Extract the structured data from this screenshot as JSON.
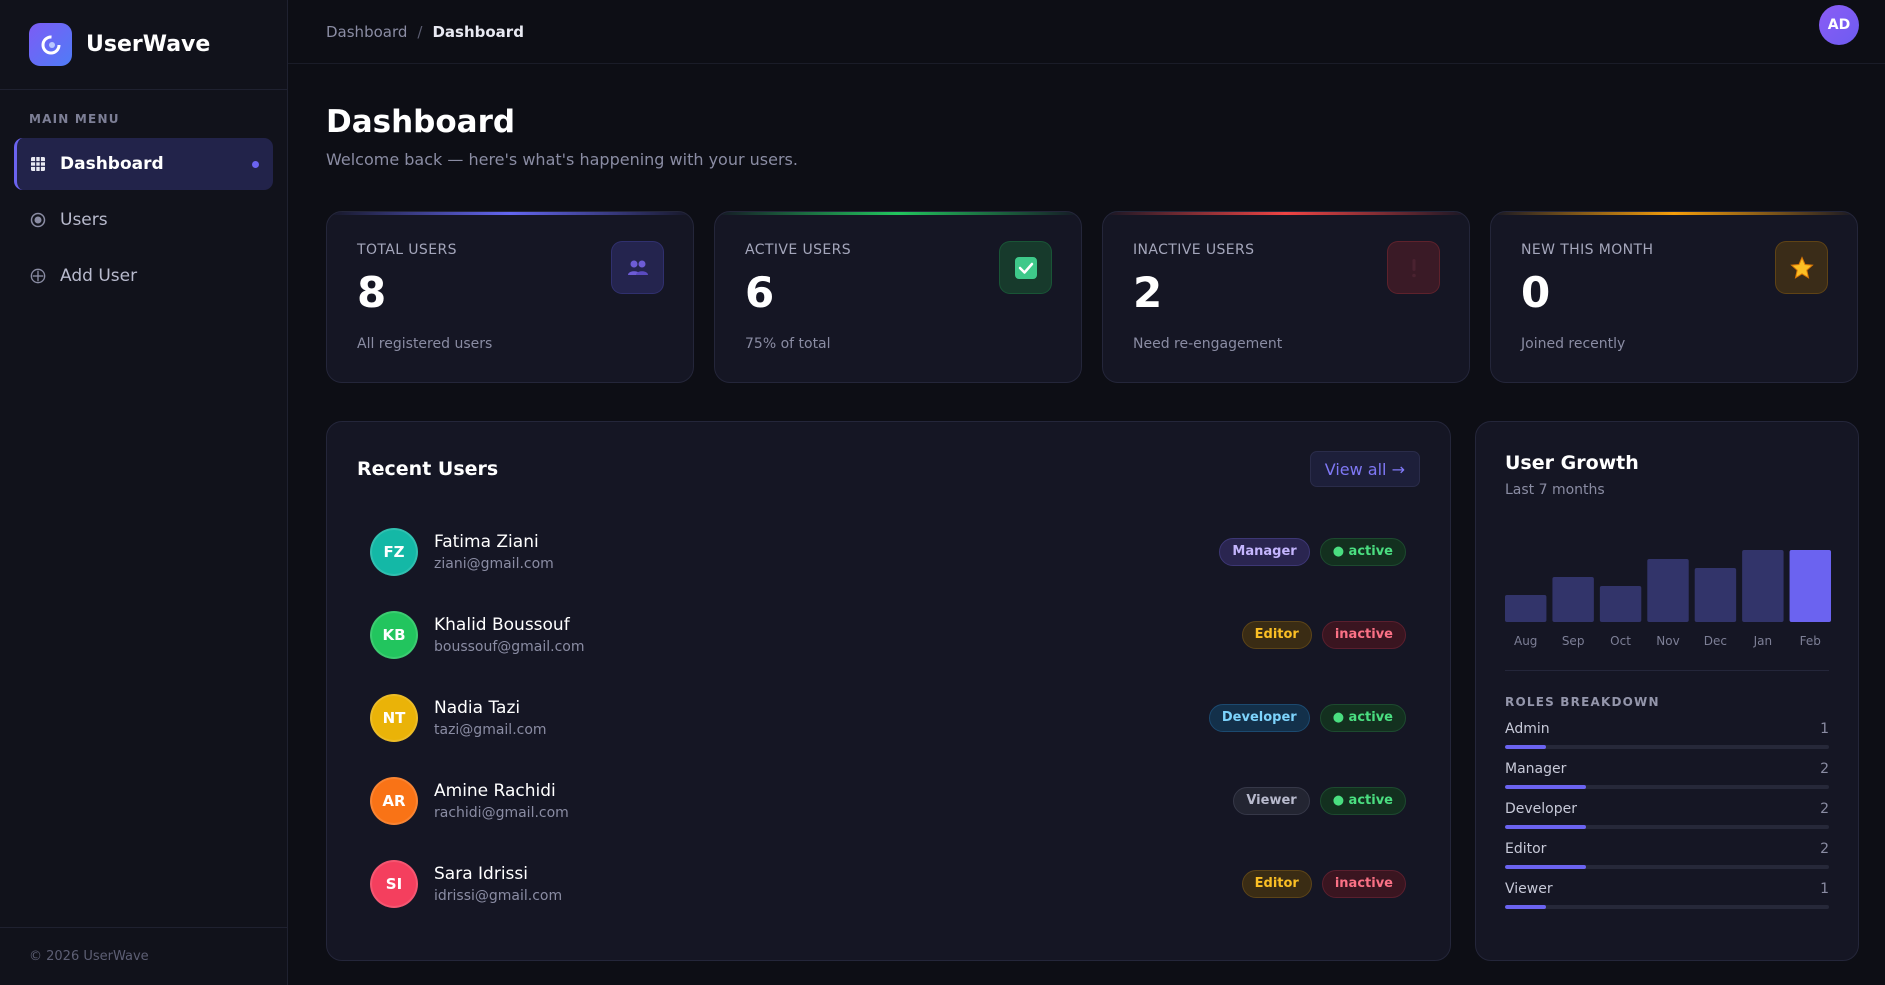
{
  "brand": {
    "name": "UserWave"
  },
  "sidebar": {
    "menu_label": "MAIN MENU",
    "items": [
      {
        "label": "Dashboard",
        "icon": "grid-icon",
        "active": true
      },
      {
        "label": "Users",
        "icon": "radio-icon",
        "active": false
      },
      {
        "label": "Add User",
        "icon": "plus-circle-icon",
        "active": false
      }
    ],
    "footer": "© 2026 UserWave"
  },
  "topbar": {
    "breadcrumb": [
      "Dashboard",
      "Dashboard"
    ],
    "separator": "/",
    "avatar": "AD"
  },
  "page": {
    "title": "Dashboard",
    "subtitle": "Welcome back — here's what's happening with your users."
  },
  "stats": [
    {
      "label": "TOTAL USERS",
      "value": "8",
      "caption": "All registered users",
      "accent": "#6366f1",
      "icon": "users-icon",
      "icon_bg": "#24244e"
    },
    {
      "label": "ACTIVE USERS",
      "value": "6",
      "caption": "75% of total",
      "accent": "#22c55e",
      "icon": "check-icon",
      "icon_bg": "#173a2c"
    },
    {
      "label": "INACTIVE USERS",
      "value": "2",
      "caption": "Need re-engagement",
      "accent": "#ef4444",
      "icon": "alert-icon",
      "icon_bg": "#3a1a26"
    },
    {
      "label": "NEW THIS MONTH",
      "value": "0",
      "caption": "Joined recently",
      "accent": "#f59e0b",
      "icon": "star-icon",
      "icon_bg": "#3a2c18"
    }
  ],
  "recent": {
    "title": "Recent Users",
    "view_all": "View all →",
    "users": [
      {
        "initials": "FZ",
        "name": "Fatima Ziani",
        "email": "ziani@gmail.com",
        "avatar_color": "#14b8a6",
        "role": "Manager",
        "status": "● active",
        "role_style": "manager",
        "status_style": "active"
      },
      {
        "initials": "KB",
        "name": "Khalid Boussouf",
        "email": "boussouf@gmail.com",
        "avatar_color": "#22c55e",
        "role": "Editor",
        "status": "inactive",
        "role_style": "editor",
        "status_style": "inactive"
      },
      {
        "initials": "NT",
        "name": "Nadia Tazi",
        "email": "tazi@gmail.com",
        "avatar_color": "#eab308",
        "role": "Developer",
        "status": "● active",
        "role_style": "developer",
        "status_style": "active"
      },
      {
        "initials": "AR",
        "name": "Amine Rachidi",
        "email": "rachidi@gmail.com",
        "avatar_color": "#f97316",
        "role": "Viewer",
        "status": "● active",
        "role_style": "viewer",
        "status_style": "active"
      },
      {
        "initials": "SI",
        "name": "Sara Idrissi",
        "email": "idrissi@gmail.com",
        "avatar_color": "#f43f5e",
        "role": "Editor",
        "status": "inactive",
        "role_style": "editor",
        "status_style": "inactive"
      }
    ]
  },
  "growth": {
    "title": "User Growth",
    "subtitle": "Last 7 months",
    "roles_title": "ROLES BREAKDOWN",
    "roles": [
      {
        "name": "Admin",
        "count": "1",
        "fraction": 0.125
      },
      {
        "name": "Manager",
        "count": "2",
        "fraction": 0.25
      },
      {
        "name": "Developer",
        "count": "2",
        "fraction": 0.25
      },
      {
        "name": "Editor",
        "count": "2",
        "fraction": 0.25
      },
      {
        "name": "Viewer",
        "count": "1",
        "fraction": 0.125
      }
    ]
  },
  "chart_data": {
    "type": "bar",
    "categories": [
      "Aug",
      "Sep",
      "Oct",
      "Nov",
      "Dec",
      "Jan",
      "Feb"
    ],
    "values": [
      3,
      5,
      4,
      7,
      6,
      8,
      8
    ],
    "ylim": [
      0,
      8
    ],
    "highlight": "Feb",
    "bar_color": "#32346a",
    "highlight_color": "#6b63f0",
    "title": "User Growth",
    "subtitle": "Last 7 months",
    "grid": false
  },
  "colors": {
    "badge": {
      "manager": {
        "bg": "#2a2550",
        "border": "#3d3775",
        "text": "#c4b5fd"
      },
      "editor": {
        "bg": "#3a2c14",
        "border": "#5c4418",
        "text": "#fbbf24"
      },
      "developer": {
        "bg": "#13304a",
        "border": "#1c4a70",
        "text": "#7dd3fc"
      },
      "viewer": {
        "bg": "#232532",
        "border": "#363848",
        "text": "#b8bacd"
      },
      "active": {
        "bg": "#13301f",
        "border": "#1d4a2f",
        "text": "#4ade80"
      },
      "inactive": {
        "bg": "#3a1520",
        "border": "#5a1f2e",
        "text": "#fb7185"
      }
    }
  }
}
